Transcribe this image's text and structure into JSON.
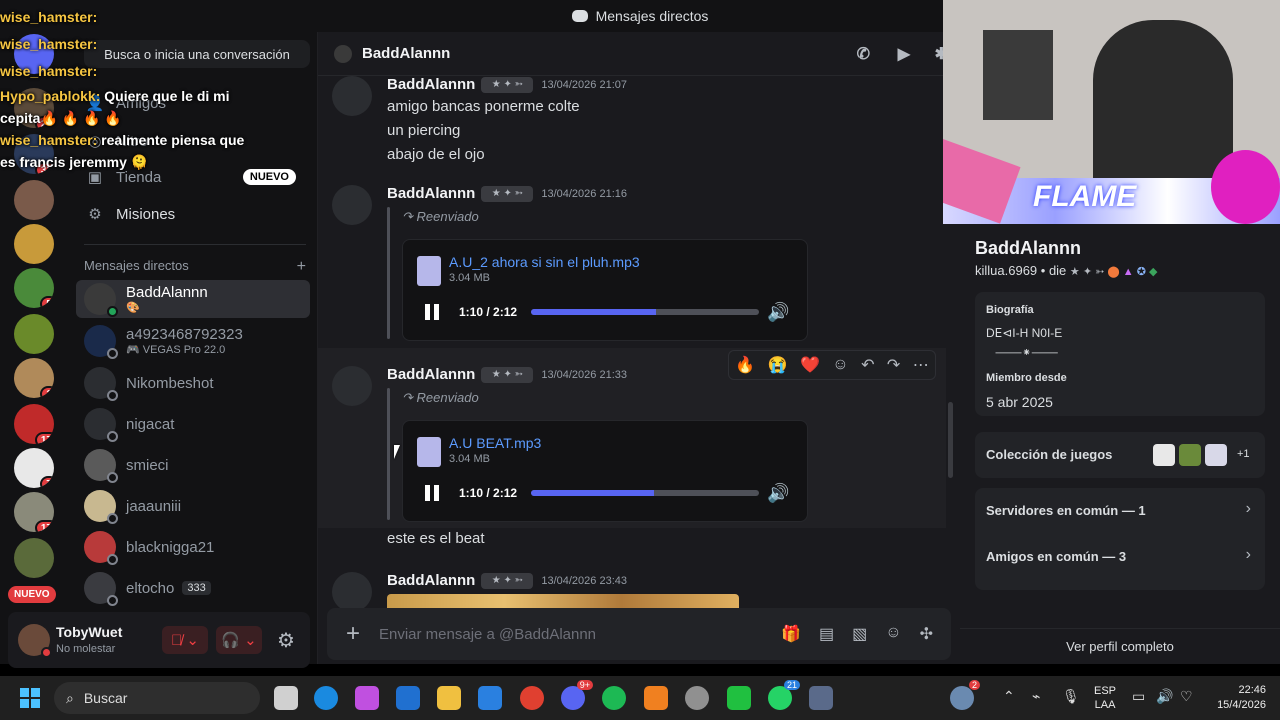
{
  "window": {
    "title": "Mensajes directos"
  },
  "search": {
    "placeholder": "Busca o inicia una conversación"
  },
  "nav": [
    {
      "label": "Amigos"
    },
    {
      "label": "Nitro"
    },
    {
      "label": "Tienda",
      "badge": "NUEVO"
    },
    {
      "label": "Misiones"
    }
  ],
  "dm_section": {
    "title": "Mensajes directos",
    "add": "+"
  },
  "dms": [
    {
      "name": "BaddAlannn",
      "sub": "🎨",
      "active": true
    },
    {
      "name": "a4923468792323",
      "sub": "🎮 VEGAS Pro 22.0"
    },
    {
      "name": "Nikombeshot",
      "sub": ""
    },
    {
      "name": "nigacat",
      "sub": ""
    },
    {
      "name": "smieci",
      "sub": ""
    },
    {
      "name": "jaaauniii",
      "sub": ""
    },
    {
      "name": "blacknigga21",
      "sub": ""
    },
    {
      "name": "eltocho",
      "sub": "",
      "extra": "333"
    }
  ],
  "servers": {
    "badges": [
      "25",
      "32",
      "5",
      "1",
      "17",
      "7",
      "17"
    ],
    "new_label": "NUEVO"
  },
  "user": {
    "name": "TobyWuet",
    "status": "No molestar"
  },
  "chat": {
    "recipient": "BaddAlannn",
    "composer_placeholder": "Enviar mensaje a @BaddAlannn",
    "messages": [
      {
        "author": "BaddAlannn",
        "time": "13/04/2026 21:07",
        "lines": [
          "amigo bancas ponerme colte",
          "un piercing",
          "abajo de el ojo"
        ]
      },
      {
        "author": "BaddAlannn",
        "time": "13/04/2026 21:16",
        "forwarded": "Reenviado",
        "file": "A.U_2 ahora si sin el pluh.mp3",
        "size": "3.04 MB",
        "playtime": "1:10 / 2:12",
        "progress": 0.55
      },
      {
        "author": "BaddAlannn",
        "time": "13/04/2026 21:33",
        "forwarded": "Reenviado",
        "file": "A.U BEAT.mp3",
        "size": "3.04 MB",
        "playtime": "1:10 / 2:12",
        "progress": 0.54,
        "after": "este es el beat"
      },
      {
        "author": "BaddAlannn",
        "time": "13/04/2026 23:43"
      }
    ],
    "reactions": [
      "🔥",
      "😭",
      "❤️"
    ]
  },
  "profile": {
    "name": "BaddAlannn",
    "handle": "killua.6969",
    "pronouns": "die",
    "bio_title": "Biografía",
    "bio_text": "D𝖤⊲I-H N0I-E",
    "member_title": "Miembro desde",
    "member_date": "5 abr 2025",
    "games": "Colección de juegos",
    "games_more": "+1",
    "servers": "Servidores en común — 1",
    "friends": "Amigos en común — 3",
    "view_full": "Ver perfil completo"
  },
  "stream_chat": [
    {
      "user": "wise_hamster:",
      "text": ""
    },
    {
      "user": "wise_hamster:",
      "text": ""
    },
    {
      "user": "wise_hamster:",
      "text": ""
    },
    {
      "user": "Hypo_pablokk:",
      "text": "Quiere que le di mi cepita🔥 🔥 🔥 🔥"
    },
    {
      "user": "wise_hamster:",
      "text": "realmente piensa que es francis jeremmy 🫠"
    }
  ],
  "webcam": {
    "banner": "FLAME"
  },
  "taskbar": {
    "search": "Buscar",
    "lang": "ESP",
    "lang2": "LAA",
    "time": "22:46",
    "date": "15/4/2026",
    "discord_badge": "9+",
    "whatsapp_badge": "21",
    "weather_badge": "2"
  },
  "colors": {
    "accent": "#5865f2",
    "link": "#5c9bff",
    "danger": "#e23c3f",
    "online": "#23a55a"
  }
}
